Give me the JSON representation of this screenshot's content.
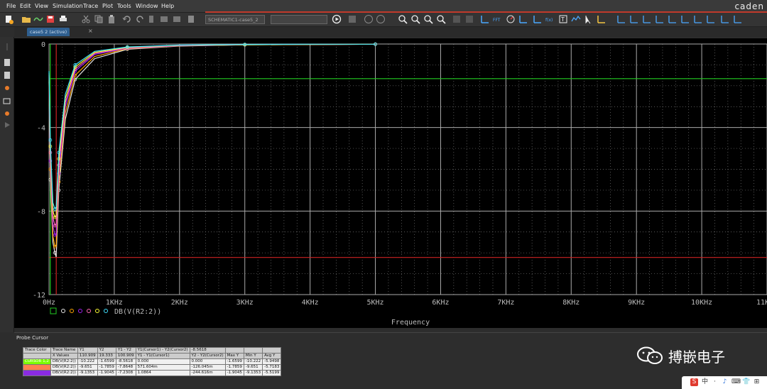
{
  "menubar": {
    "items": [
      "File",
      "Edit",
      "View",
      "Simulation",
      "Trace",
      "Plot",
      "Tools",
      "Window",
      "Help"
    ],
    "brand": "caden"
  },
  "toolbar": {
    "schematic_box": "SCHEMATIC1-case5_2"
  },
  "tabs": [
    {
      "label": "case5 2 (active)",
      "close": "×"
    }
  ],
  "chart_data": {
    "type": "line",
    "title": "",
    "xlabel": "Frequency",
    "ylabel": "",
    "xlim": [
      0,
      11000
    ],
    "ylim": [
      -12,
      0
    ],
    "x_ticks": [
      "0Hz",
      "1KHz",
      "2KHz",
      "3KHz",
      "4KHz",
      "5KHz",
      "6KHz",
      "7KHz",
      "8KHz",
      "9KHz",
      "10KHz",
      "11KHz"
    ],
    "x_tick_values": [
      0,
      1000,
      2000,
      3000,
      4000,
      5000,
      6000,
      7000,
      8000,
      9000,
      10000,
      11000
    ],
    "y_ticks": [
      "0",
      "-4",
      "-8",
      "-12"
    ],
    "y_tick_values": [
      0,
      -4,
      -8,
      -12
    ],
    "grid": true,
    "legend_text": "DB(V(R2:2))",
    "cursor_lines": {
      "green_y": -1.6599,
      "red_y": -10.222,
      "green_x": 19.333,
      "red_x": 110.909
    },
    "series": [
      {
        "color": "#e8e8e8",
        "x": [
          0,
          20,
          60,
          90,
          110,
          150,
          250,
          400,
          700,
          1200,
          2000,
          3000,
          4000,
          5000
        ],
        "values": [
          -1.8,
          -6.5,
          -9.5,
          -10.0,
          -10.2,
          -7.0,
          -3.6,
          -1.7,
          -0.7,
          -0.25,
          -0.1,
          -0.04,
          -0.02,
          -0.01
        ]
      },
      {
        "color": "#ffa500",
        "x": [
          0,
          20,
          60,
          90,
          110,
          150,
          250,
          400,
          700,
          1200,
          2000,
          3000,
          4000,
          5000
        ],
        "values": [
          -1.7,
          -6.0,
          -9.2,
          -9.7,
          -9.65,
          -6.6,
          -3.3,
          -1.5,
          -0.6,
          -0.22,
          -0.09,
          -0.04,
          -0.02,
          -0.01
        ]
      },
      {
        "color": "#a020f0",
        "x": [
          0,
          20,
          60,
          90,
          110,
          150,
          250,
          400,
          700,
          1200,
          2000,
          3000,
          4000,
          5000
        ],
        "values": [
          -1.6,
          -5.6,
          -8.7,
          -9.15,
          -9.14,
          -6.2,
          -3.0,
          -1.3,
          -0.5,
          -0.2,
          -0.08,
          -0.03,
          -0.02,
          -0.01
        ]
      },
      {
        "color": "#ff69b4",
        "x": [
          0,
          20,
          60,
          90,
          110,
          150,
          250,
          400,
          700,
          1200,
          2000,
          3000,
          4000,
          5000
        ],
        "values": [
          -1.5,
          -5.2,
          -8.3,
          -8.7,
          -8.6,
          -5.8,
          -2.8,
          -1.2,
          -0.45,
          -0.18,
          -0.07,
          -0.03,
          -0.02,
          -0.01
        ]
      },
      {
        "color": "#ffff33",
        "x": [
          0,
          20,
          60,
          90,
          110,
          150,
          250,
          400,
          700,
          1200,
          2000,
          3000,
          4000,
          5000
        ],
        "values": [
          -1.4,
          -4.9,
          -8.0,
          -8.3,
          -8.2,
          -5.5,
          -2.6,
          -1.1,
          -0.4,
          -0.16,
          -0.06,
          -0.03,
          -0.02,
          -0.01
        ]
      },
      {
        "color": "#40e0ff",
        "x": [
          0,
          20,
          60,
          90,
          110,
          150,
          250,
          400,
          700,
          1200,
          2000,
          3000,
          4000,
          5000
        ],
        "values": [
          -1.3,
          -4.6,
          -7.6,
          -7.9,
          -7.8,
          -5.2,
          -2.4,
          -1.0,
          -0.35,
          -0.14,
          -0.05,
          -0.02,
          -0.01,
          -0.01
        ]
      }
    ]
  },
  "probe_cursor": {
    "title": "Probe Cursor",
    "header": [
      "Trace Color",
      "Trace Name",
      "Y1",
      "Y2",
      "Y1 - Y2",
      "Y1(Cursor1) - Y2(Cursor2)",
      "-8.5618",
      "",
      "",
      ""
    ],
    "subheader": [
      "",
      "X Values",
      "110.909",
      "19.333",
      "100.909",
      "Y1 - Y1(Cursor1)",
      "Y2 - Y2(Cursor2)",
      "Max Y",
      "Min Y",
      "Avg Y"
    ],
    "rows": [
      {
        "color": "#7cfc00",
        "cells": [
          "CURSOR 1,2",
          "DB(V(R2:2))",
          "-10.222",
          "-1.6599",
          "-8.5618",
          "0.000",
          "0.000",
          "-1.6599",
          "-10.222",
          "-5.9498"
        ]
      },
      {
        "color": "#ff7f50",
        "cells": [
          "",
          "DB(V(R2:2))",
          "-9.651",
          "-1.7859",
          "-7.8648",
          "571.604m",
          "-126.045m",
          "-1.7859",
          "-9.651",
          "-5.7183"
        ]
      },
      {
        "color": "#8a2be2",
        "cells": [
          "",
          "DB(V(R2:2))",
          "-9.1353",
          "-1.9045",
          "-7.2308",
          "1.0864",
          "-244.616m",
          "-1.9045",
          "-9.1353",
          "-5.5199"
        ]
      }
    ]
  },
  "watermark": {
    "text": "搏嵌电子",
    "icon": "wechat-icon"
  },
  "taskbar": {
    "items": [
      "S",
      "中",
      "·",
      "♪",
      "⌨",
      "👕",
      "⊞"
    ]
  }
}
